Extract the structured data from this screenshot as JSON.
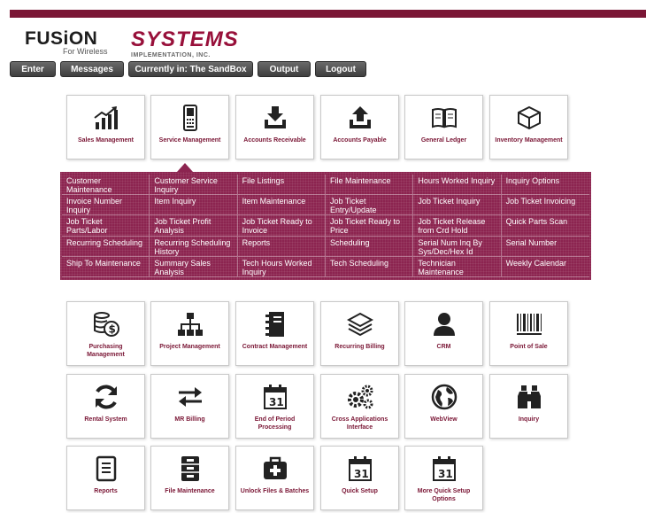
{
  "header": {
    "logo_fusion": "FUSiON",
    "logo_wireless": "For Wireless",
    "logo_systems": "SYSTEMS",
    "logo_impl": "IMPLEMENTATION, INC."
  },
  "toolbar": {
    "enter": "Enter",
    "messages": "Messages",
    "current": "Currently in: The SandBox",
    "output": "Output",
    "logout": "Logout"
  },
  "top_tiles": [
    {
      "label": "Sales Management",
      "icon": "bar-chart-icon"
    },
    {
      "label": "Service Management",
      "icon": "mobile-phone-icon"
    },
    {
      "label": "Accounts Receivable",
      "icon": "tray-download-icon"
    },
    {
      "label": "Accounts Payable",
      "icon": "tray-upload-icon"
    },
    {
      "label": "General Ledger",
      "icon": "book-icon"
    },
    {
      "label": "Inventory Management",
      "icon": "box-icon"
    }
  ],
  "submenu": {
    "active_tile": "Service Management",
    "items": [
      "Customer Maintenance",
      "Customer Service Inquiry",
      "File Listings",
      "File Maintenance",
      "Hours Worked Inquiry",
      "Inquiry Options",
      "Invoice Number Inquiry",
      "Item Inquiry",
      "Item Maintenance",
      "Job Ticket Entry/Update",
      "Job Ticket Inquiry",
      "Job Ticket Invoicing",
      "Job Ticket Parts/Labor",
      "Job Ticket Profit Analysis",
      "Job Ticket Ready to Invoice",
      "Job Ticket Ready to Price",
      "Job Ticket Release from Crd Hold",
      "Quick Parts Scan",
      "Recurring Scheduling",
      "Recurring Scheduling History",
      "Reports",
      "Scheduling",
      "Serial Num Inq By Sys/Dec/Hex Id",
      "Serial Number",
      "Ship To Maintenance",
      "Summary Sales Analysis",
      "Tech Hours Worked Inquiry",
      "Tech Scheduling",
      "Technician Maintenance",
      "Weekly Calendar"
    ]
  },
  "bottom_tiles": [
    {
      "label": "Purchasing Management",
      "icon": "coins-icon"
    },
    {
      "label": "Project Management",
      "icon": "org-chart-icon"
    },
    {
      "label": "Contract Management",
      "icon": "notebook-icon"
    },
    {
      "label": "Recurring Billing",
      "icon": "layers-icon"
    },
    {
      "label": "CRM",
      "icon": "user-icon"
    },
    {
      "label": "Point of Sale",
      "icon": "barcode-icon"
    },
    {
      "label": "Rental System",
      "icon": "refresh-icon"
    },
    {
      "label": "MR Billing",
      "icon": "exchange-arrows-icon"
    },
    {
      "label": "End of Period Processing",
      "icon": "calendar-icon"
    },
    {
      "label": "Cross Applications Interface",
      "icon": "gears-icon"
    },
    {
      "label": "WebView",
      "icon": "globe-icon"
    },
    {
      "label": "Inquiry",
      "icon": "binoculars-icon"
    },
    {
      "label": "Reports",
      "icon": "document-list-icon"
    },
    {
      "label": "File Maintenance",
      "icon": "file-cabinet-icon"
    },
    {
      "label": "Unlock Files & Batches",
      "icon": "medical-kit-icon"
    },
    {
      "label": "Quick Setup",
      "icon": "calendar-icon"
    },
    {
      "label": "More Quick Setup Options",
      "icon": "calendar-icon"
    }
  ],
  "colors": {
    "brand": "#7a1635",
    "submenu_bg": "#8c2450",
    "toolbar": "#4a4a4a"
  }
}
